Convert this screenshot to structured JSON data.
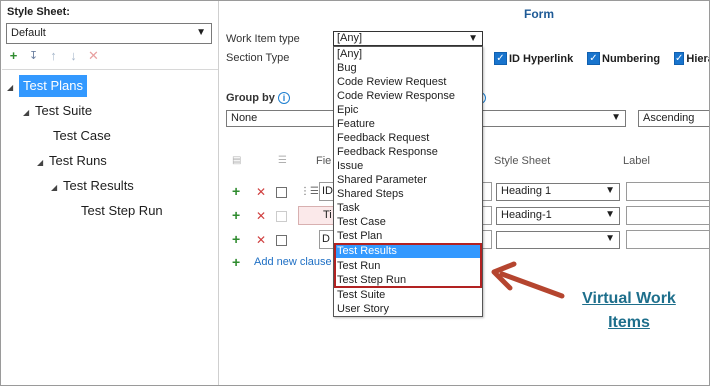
{
  "left": {
    "style_sheet_label": "Style Sheet:",
    "style_sheet_value": "Default",
    "toolbar_icons": [
      "plus-icon",
      "stack-down-icon",
      "arrow-up-icon",
      "arrow-down-icon",
      "close-icon"
    ],
    "tree": [
      {
        "label": "Test Plans",
        "selected": true
      },
      {
        "label": "Test Suite"
      },
      {
        "label": "Test Case"
      },
      {
        "label": "Test Runs"
      },
      {
        "label": "Test Results"
      },
      {
        "label": "Test Step Run"
      }
    ]
  },
  "right": {
    "form_title": "Form",
    "work_item_type_label": "Work Item type",
    "work_item_type_value": "[Any]",
    "section_type_label": "Section Type",
    "checks": {
      "id_hyperlink": "ID Hyperlink",
      "numbering": "Numbering",
      "hier": "Hiera"
    },
    "group_by_label": "Group by",
    "group_by_value": "None",
    "sort_value": "Ascending",
    "col_field": "Fie",
    "col_style_sheet": "Style Sheet",
    "col_label": "Label",
    "rows": [
      {
        "field": "ID",
        "style": "Heading 1"
      },
      {
        "field": "Ti",
        "style": "Heading-1"
      },
      {
        "field": "D",
        "style": ""
      }
    ],
    "add_clause": "Add new clause"
  },
  "dropdown": {
    "items": [
      "[Any]",
      "Bug",
      "Code Review Request",
      "Code Review Response",
      "Epic",
      "Feature",
      "Feedback Request",
      "Feedback Response",
      "Issue",
      "Shared Parameter",
      "Shared Steps",
      "Task",
      "Test Case",
      "Test Plan",
      "Test Results",
      "Test Run",
      "Test Step Run",
      "Test Suite",
      "User Story"
    ],
    "highlighted": "Test Results"
  },
  "callout": {
    "line1": "Virtual Work",
    "line2": "Items",
    "color": "#1e6f8c",
    "box_color": "#b22222"
  }
}
